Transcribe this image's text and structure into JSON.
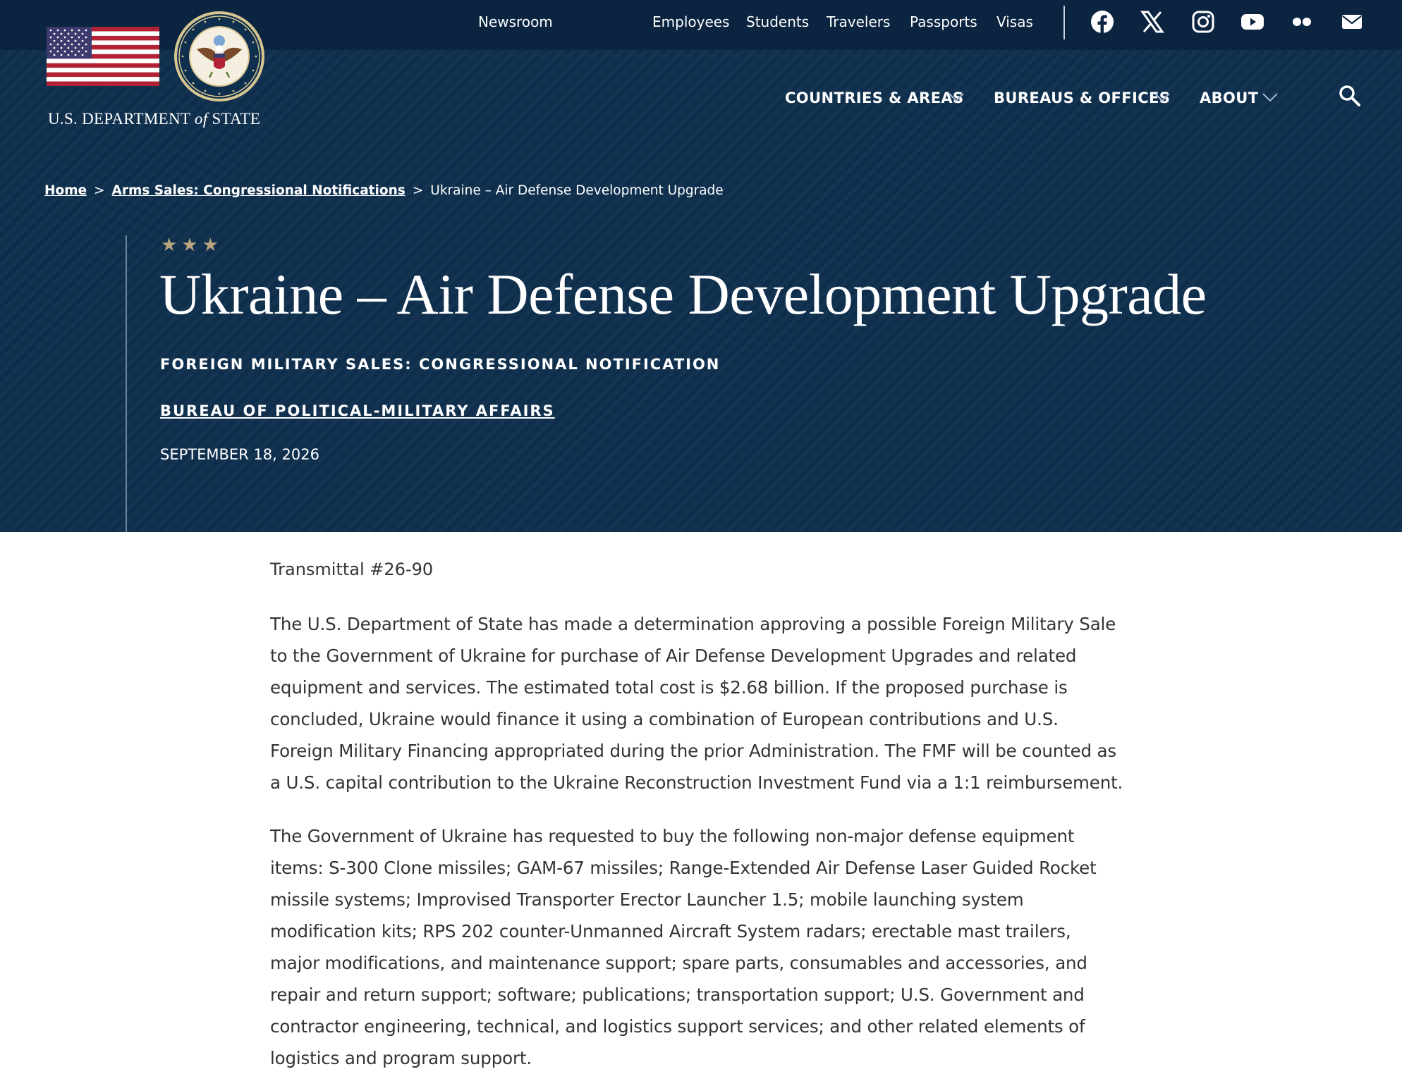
{
  "top_nav": {
    "newsroom": "Newsroom",
    "employees": "Employees",
    "students": "Students",
    "travelers": "Travelers",
    "passports": "Passports",
    "visas": "Visas"
  },
  "social": [
    "facebook-icon",
    "x-icon",
    "instagram-icon",
    "youtube-icon",
    "flickr-icon",
    "email-icon"
  ],
  "logo": {
    "dept_prefix": "U.S. DEPARTMENT ",
    "dept_of": "of",
    "dept_suffix": " STATE"
  },
  "main_nav": {
    "countries": "COUNTRIES & AREAS",
    "bureaus": "BUREAUS & OFFICES",
    "about": "ABOUT"
  },
  "breadcrumb": {
    "home": "Home",
    "sep1": ">",
    "arms": "Arms Sales: Congressional Notifications",
    "sep2": ">",
    "current": "Ukraine – Air Defense Development Upgrade"
  },
  "hero": {
    "stars": "★★★",
    "title": "Ukraine – Air Defense Development Upgrade",
    "category": "FOREIGN MILITARY SALES: CONGRESSIONAL NOTIFICATION",
    "bureau": "BUREAU OF POLITICAL-MILITARY AFFAIRS",
    "date": "SEPTEMBER 18, 2026"
  },
  "content": {
    "transmittal": "Transmittal #26-90",
    "paragraph1": "The U.S. Department of State has made a determination approving a possible Foreign Military Sale to the Government of Ukraine for purchase of Air Defense Development Upgrades and related equipment and services. The estimated total cost is $2.68 billion. If the proposed purchase is concluded, Ukraine would finance it using a combination of European contributions and U.S. Foreign Military Financing appropriated during the prior Administration. The FMF will be counted as a U.S. capital contribution to the Ukraine Reconstruction Investment Fund via a 1:1 reimbursement.",
    "paragraph2": "The Government of Ukraine has requested to buy the following non-major defense equipment items: S-300 Clone missiles; GAM-67 missiles; Range-Extended Air Defense Laser Guided Rocket missile systems; Improvised Transporter Erector Launcher 1.5; mobile launching system modification kits; RPS 202 counter-Unmanned Aircraft System radars; erectable mast trailers, major modifications, and maintenance support; spare parts, consumables and accessories, and repair and return support; software; publications; transportation support; U.S. Government and contractor engineering, technical, and logistics support services; and other related elements of logistics and program support."
  },
  "colors": {
    "header_bg": "#0e2f4e",
    "topbar_bg": "#0b2440",
    "star_gold": "#b8a57c",
    "body_text": "#333333"
  }
}
